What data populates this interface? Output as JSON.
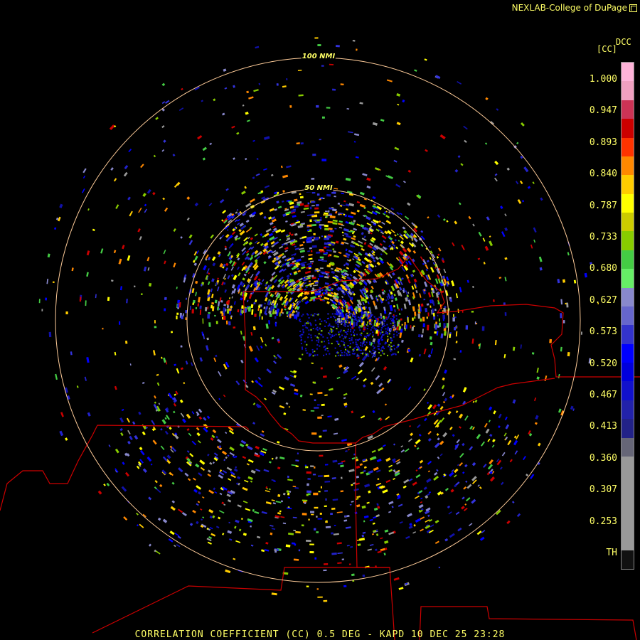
{
  "credit": "NEXLAB-College of DuPage",
  "credit_icon": "external-link-icon",
  "scale": {
    "product": "DCC",
    "unit": "[CC]",
    "ticks": [
      "1.000",
      "0.947",
      "0.893",
      "0.840",
      "0.787",
      "0.733",
      "0.680",
      "0.627",
      "0.573",
      "0.520",
      "0.467",
      "0.413",
      "0.360",
      "0.307",
      "0.253",
      "TH"
    ],
    "colors": [
      "#ffb3d9",
      "#f0a0c0",
      "#cc3355",
      "#cc0000",
      "#ff3300",
      "#ff8800",
      "#ffcc00",
      "#ffff00",
      "#cccc00",
      "#88cc00",
      "#44cc44",
      "#66ee66",
      "#8888cc",
      "#6666cc",
      "#3333cc",
      "#0000ff",
      "#0000dd",
      "#1111cc",
      "#2222aa",
      "#222288",
      "#666677",
      "#999999",
      "#999999",
      "#999999",
      "#999999",
      "#999999",
      "#111111"
    ]
  },
  "rings": [
    "100 NMI",
    "50 NMI"
  ],
  "footer": "CORRELATION COEFFICIENT (CC) 0.5 DEG - KAPD 10 DEC 25 23:28",
  "colors": {
    "label": "#ffff66",
    "range_ring": "#ffcc99",
    "boundary": "#cc0000",
    "background": "#000000"
  }
}
